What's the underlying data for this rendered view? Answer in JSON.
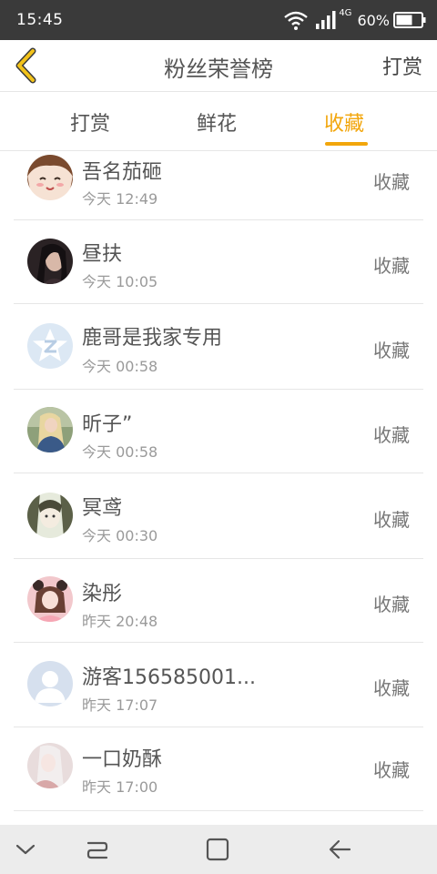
{
  "status_bar": {
    "time": "15:45",
    "network": "4G",
    "battery": "60%"
  },
  "header": {
    "title": "粉丝荣誉榜",
    "action": "打赏"
  },
  "tabs": [
    {
      "label": "打赏"
    },
    {
      "label": "鲜花"
    },
    {
      "label": "收藏",
      "active": true
    }
  ],
  "colors": {
    "accent": "#f2a60c",
    "back_icon": "#f2c21a"
  },
  "list": [
    {
      "name": "吾名茄砸",
      "time": "今天 12:49",
      "action": "收藏",
      "avatar": "cartoon-girl-avatar"
    },
    {
      "name": "昼扶",
      "time": "今天 10:05",
      "action": "收藏",
      "avatar": "dark-photo-avatar"
    },
    {
      "name": "鹿哥是我家专用",
      "time": "今天 00:58",
      "action": "收藏",
      "avatar": "default-star-avatar"
    },
    {
      "name": "昕子”",
      "time": "今天 00:58",
      "action": "收藏",
      "avatar": "blonde-girl-avatar"
    },
    {
      "name": "冥鸢",
      "time": "今天 00:30",
      "action": "收藏",
      "avatar": "anime-girl-avatar"
    },
    {
      "name": "染彤",
      "time": "昨天 20:48",
      "action": "收藏",
      "avatar": "pink-girl-avatar"
    },
    {
      "name": "游客156585001...",
      "time": "昨天 17:07",
      "action": "收藏",
      "avatar": "default-user-avatar"
    },
    {
      "name": "一口奶酥",
      "time": "昨天 17:00",
      "action": "收藏",
      "avatar": "pale-girl-avatar"
    }
  ]
}
